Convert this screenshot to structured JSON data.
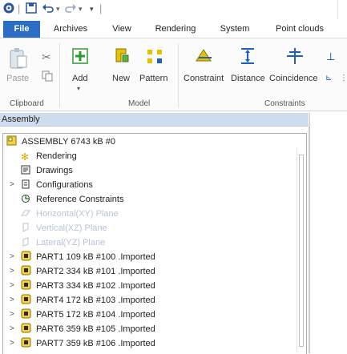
{
  "quick_access": {
    "app_icon": "app-gear-icon",
    "save_icon": "save-icon",
    "undo_icon": "undo-icon",
    "redo_icon": "redo-icon",
    "customize_icon": "customize-qat-icon"
  },
  "tabs": [
    {
      "label": "File",
      "active": true
    },
    {
      "label": "Archives"
    },
    {
      "label": "View"
    },
    {
      "label": "Rendering"
    },
    {
      "label": "System"
    },
    {
      "label": "Point clouds"
    }
  ],
  "ribbon": {
    "clipboard": {
      "label": "Clipboard",
      "paste": "Paste"
    },
    "model": {
      "label": "Model",
      "add": "Add",
      "new": "New",
      "pattern": "Pattern"
    },
    "constraints": {
      "label": "Constraints",
      "constraint": "Constraint",
      "distance": "Distance",
      "coincidence": "Coincidence"
    }
  },
  "panel": {
    "title": "Assembly"
  },
  "tree": {
    "root": "ASSEMBLY 6743 kB #0",
    "items": [
      {
        "label": "Rendering",
        "icon": "rendering-icon",
        "ghost": false,
        "expandable": false
      },
      {
        "label": "Drawings",
        "icon": "drawings-icon",
        "ghost": false,
        "expandable": false
      },
      {
        "label": "Configurations",
        "icon": "configurations-icon",
        "ghost": false,
        "expandable": true
      },
      {
        "label": "Reference Constraints",
        "icon": "reference-constraints-icon",
        "ghost": false,
        "expandable": false
      },
      {
        "label": "Horizontal(XY) Plane",
        "icon": "plane-icon",
        "ghost": true,
        "expandable": false
      },
      {
        "label": "Vertical(XZ) Plane",
        "icon": "plane-icon",
        "ghost": true,
        "expandable": false
      },
      {
        "label": "Lateral(YZ) Plane",
        "icon": "plane-icon",
        "ghost": true,
        "expandable": false
      },
      {
        "label": "PART1 109 kB #100 .Imported",
        "icon": "part-icon",
        "ghost": false,
        "expandable": true
      },
      {
        "label": "PART2 334 kB #101 .Imported",
        "icon": "part-icon",
        "ghost": false,
        "expandable": true
      },
      {
        "label": "PART3 334 kB #102 .Imported",
        "icon": "part-icon",
        "ghost": false,
        "expandable": true
      },
      {
        "label": "PART4 172 kB #103 .Imported",
        "icon": "part-icon",
        "ghost": false,
        "expandable": true
      },
      {
        "label": "PART5 172 kB #104 .Imported",
        "icon": "part-icon",
        "ghost": false,
        "expandable": true
      },
      {
        "label": "PART6 359 kB #105 .Imported",
        "icon": "part-icon",
        "ghost": false,
        "expandable": true
      },
      {
        "label": "PART7 359 kB #106 .Imported",
        "icon": "part-icon",
        "ghost": false,
        "expandable": true
      }
    ]
  },
  "colors": {
    "accent": "#2b6cc4",
    "part_icon": "#c9a100",
    "ribbon_icon_green": "#2e9a2e",
    "ribbon_icon_blue": "#1f5fbf"
  }
}
